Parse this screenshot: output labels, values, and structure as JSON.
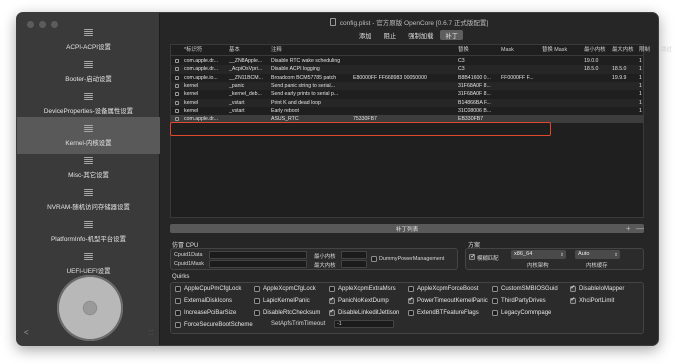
{
  "window": {
    "title": "config.plist - 官方原版 OpenCore [0.6.7 正式版配置]"
  },
  "sidebar": {
    "items": [
      {
        "label": "ACPI-ACPI设置",
        "active": false
      },
      {
        "label": "Booter-启动设置",
        "active": false
      },
      {
        "label": "DeviceProperties-设备属性设置",
        "active": false
      },
      {
        "label": "Kernel-内核设置",
        "active": true
      },
      {
        "label": "Misc-其它设置",
        "active": false
      },
      {
        "label": "NVRAM-随机访问存储器设置",
        "active": false
      },
      {
        "label": "PlatformInfo-机型平台设置",
        "active": false
      },
      {
        "label": "UEFI-UEFI设置",
        "active": false
      }
    ]
  },
  "tabs": [
    {
      "label": "添加",
      "active": false
    },
    {
      "label": "阻止",
      "active": false
    },
    {
      "label": "强制加载",
      "active": false
    },
    {
      "label": "补丁",
      "active": true
    }
  ],
  "table": {
    "headers": [
      "*标识符",
      "基本",
      "注释",
      "",
      "替换",
      "Mask",
      "替换 Mask",
      "最小内核",
      "最大内核",
      "限制",
      "跳过"
    ],
    "rows": [
      [
        "com.apple.dr...",
        "__ZN8Apple...",
        "Disable RTC wake scheduling",
        "",
        "C3",
        "",
        "",
        "19.0.0",
        "",
        "1",
        "0"
      ],
      [
        "com.apple.dr...",
        "_AcpiOsVpri...",
        "Disable ACPI logging",
        "",
        "C3",
        "",
        "",
        "18.5.0",
        "18.5.0",
        "1",
        "0"
      ],
      [
        "com.apple.io...",
        "__ZN11BCM...",
        "Broadcom BCM57785 patch",
        "E80000FF FF668983 00050000",
        "B8B41600 0...",
        "FF0000FF F...",
        "",
        "",
        "19.9.9",
        "1",
        "0"
      ],
      [
        "kernel",
        "_panic",
        "Send panic string to serial...",
        "",
        "31F68A0F 8...",
        "",
        "",
        "",
        "",
        "1",
        "0"
      ],
      [
        "kernel",
        "_kernel_deb...",
        "Send early prints to serial p...",
        "",
        "31F68A0F 8...",
        "",
        "",
        "",
        "",
        "1",
        "0"
      ],
      [
        "kernel",
        "_vstart",
        "Print K and dead loop",
        "",
        "B14866BA F...",
        "",
        "",
        "",
        "",
        "1",
        "0"
      ],
      [
        "kernel",
        "_vstart",
        "Early reboot",
        "",
        "31C08006 B...",
        "",
        "",
        "",
        "",
        "1",
        "0"
      ],
      [
        "com.apple.dr...",
        "",
        "ASUS_RTC",
        "75330FB7",
        "EB330FB7",
        "",
        "",
        "",
        "",
        "",
        "1"
      ]
    ],
    "footer_label": "补丁列表",
    "plus": "+",
    "minus": "—"
  },
  "cpu": {
    "title": "仿冒 CPU",
    "cpuid1data_label": "Cpuid1Data",
    "cpuid1data_value": "",
    "cpuid1mask_label": "Cpuid1Mask",
    "cpuid1mask_value": "",
    "min_kernel_label": "最小内核",
    "max_kernel_label": "最大内核",
    "dpm_label": "DummyPowerManagement",
    "dpm_checked": false
  },
  "scheme": {
    "title": "方案",
    "fuzzy_label": "模糊匹配",
    "fuzzy_checked": true,
    "arch_value": "x86_64",
    "arch_label": "内核架构",
    "cache_value": "Auto",
    "cache_label": "内核缓存"
  },
  "quirks": {
    "title": "Quirks",
    "rows": [
      [
        {
          "label": "AppleCpuPmCfgLock",
          "checked": false
        },
        {
          "label": "AppleXcpmCfgLock",
          "checked": false
        },
        {
          "label": "AppleXcpmExtraMsrs",
          "checked": false
        },
        {
          "label": "AppleXcpmForceBoost",
          "checked": false
        },
        {
          "label": "CustomSMBIOSGuid",
          "checked": false
        },
        {
          "label": "DisableIoMapper",
          "checked": true
        }
      ],
      [
        {
          "label": "ExternalDiskIcons",
          "checked": false
        },
        {
          "label": "LapicKernelPanic",
          "checked": false
        },
        {
          "label": "PanicNoKextDump",
          "checked": true
        },
        {
          "label": "PowerTimeoutKernelPanic",
          "checked": true
        },
        {
          "label": "ThirdPartyDrives",
          "checked": false
        },
        {
          "label": "XhciPortLimit",
          "checked": true
        }
      ],
      [
        {
          "label": "IncreasePciBarSize",
          "checked": false
        },
        {
          "label": "DisableRtcChecksum",
          "checked": false
        },
        {
          "label": "DisableLinkeditJettison",
          "checked": true
        },
        {
          "label": "ExtendBTFeatureFlags",
          "checked": false
        },
        {
          "label": "LegacyCommpage",
          "checked": false
        }
      ],
      [
        {
          "label": "ForceSecureBootScheme",
          "checked": false
        }
      ]
    ],
    "trim_label": "SetApfsTrimTimeout",
    "trim_value": "-1"
  },
  "colors": {
    "highlight": "#e0472b",
    "window_bg": "#262626",
    "sidebar_bg": "#3a3a3a"
  }
}
